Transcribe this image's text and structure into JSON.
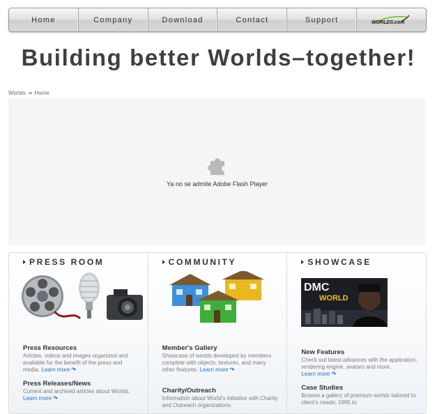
{
  "nav": {
    "items": [
      "Home",
      "Company",
      "Download",
      "Contact",
      "Support"
    ],
    "logo_text": "WORLDS.com"
  },
  "headline": "Building better Worlds–together!",
  "breadcrumb": {
    "root": "Worlds",
    "current": "Home"
  },
  "flash": {
    "message": "Ya no se admite Adobe Flash Player"
  },
  "panels": {
    "press_room": {
      "title": "PRESS ROOM",
      "items": [
        {
          "title": "Press Resources",
          "desc": "Articles, videos and images organized and available for the benefit of the press and media.",
          "link": "Learn more"
        },
        {
          "title": "Press Releases/News",
          "desc": "Current and archived articles about Worlds.",
          "link": "Learn more"
        }
      ]
    },
    "community": {
      "title": "COMMUNITY",
      "items": [
        {
          "title": "Member's Gallery",
          "desc": "Showcase of worlds developed by members complete with objects, textures, and many other features.",
          "link": "Learn more"
        },
        {
          "title": "Charity/Outreach",
          "desc": "Information about World's initiative with Charity and Outreach organizations.",
          "link": ""
        }
      ]
    },
    "showcase": {
      "title": "SHOWCASE",
      "image_text": {
        "top": "DMC",
        "bottom": "WORLD"
      },
      "items": [
        {
          "title": "New Features",
          "desc": "Check out latest advances with the application, rendering engine, avatars and more.",
          "link": "Learn more"
        },
        {
          "title": "Case Studies",
          "desc": "Browse a gallery of premium worlds tailored to client's needs: 1995 to",
          "link": ""
        }
      ]
    }
  },
  "colors": {
    "link": "#2a6fc9",
    "accent_green": "#6abf2e",
    "logo_swoosh": "#6abf2e"
  }
}
